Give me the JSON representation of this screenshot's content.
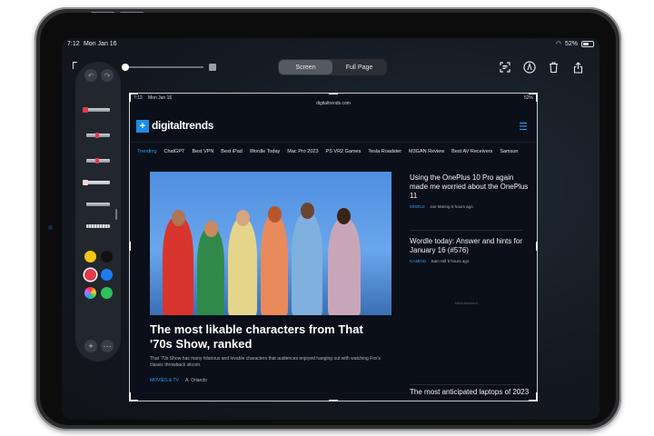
{
  "status_bar": {
    "time": "7:12",
    "date": "Mon Jan 16",
    "battery": "52%"
  },
  "toolbar": {
    "segments": [
      "Screen",
      "Full Page"
    ],
    "active_segment": "Screen"
  },
  "icons": {
    "crop": "crop-corner-icon",
    "undo": "undo-icon",
    "redo": "redo-icon",
    "text": "text-recognition-icon",
    "markup": "markup-pen-icon",
    "delete": "trash-icon",
    "share": "share-icon"
  },
  "palette": {
    "colors": [
      "#f5c518",
      "#111111",
      "#e23b4a",
      "#1e7cf2",
      "#c9a0ff",
      "#2fc15a"
    ],
    "selected_color": "#e23b4a",
    "add_label": "+",
    "more_label": "···"
  },
  "capture": {
    "status": {
      "time": "7:12",
      "date": "Mon Jan 16",
      "url": "digitaltrends.com",
      "battery": "52%"
    },
    "site": {
      "logo": "digitaltrends"
    },
    "nav": [
      "Trending",
      "ChatGPT",
      "Best VPN",
      "Best iPad",
      "Wordle Today",
      "Mac Pro 2023",
      "PS VR2 Games",
      "Tesla Roadster",
      "M3GAN Review",
      "Best AV Receivers",
      "Samsun"
    ],
    "hero": {
      "title": "The most likable characters from That '70s Show, ranked",
      "description": "That '70s Show has many hilarious and lovable characters that audiences enjoyed hanging out with watching Fox's classic throwback sitcom.",
      "category": "MOVIES & TV",
      "author": "A. Orlando"
    },
    "side_articles": [
      {
        "title": "Using the OnePlus 10 Pro again made me worried about the OnePlus 11",
        "category": "MOBILE",
        "author": "Joe Maring",
        "time": "9 hours ago"
      },
      {
        "title": "Wordle today: Answer and hints for January 16 (#576)",
        "category": "GAMING",
        "author": "Sam Hill",
        "time": "9 hours ago"
      },
      {
        "title": "The most anticipated laptops of 2023"
      }
    ],
    "advertisement": "Advertisement"
  }
}
